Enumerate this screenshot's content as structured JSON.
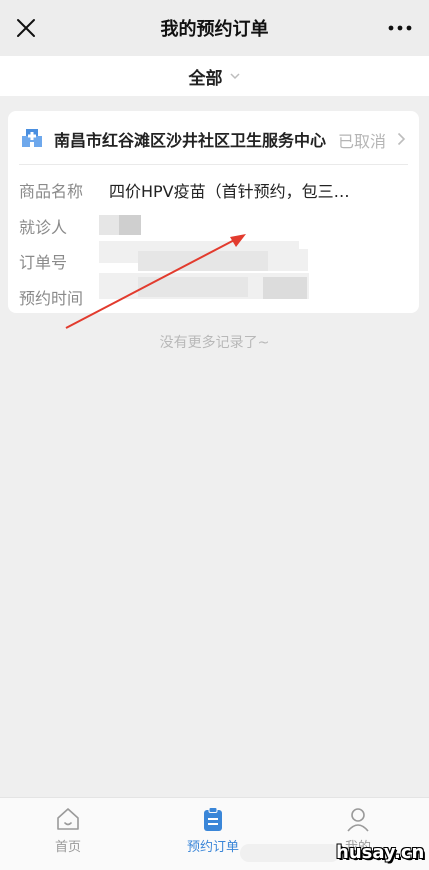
{
  "header": {
    "title": "我的预约订单",
    "close_icon": "close-icon",
    "more_icon": "more-icon"
  },
  "filter": {
    "label": "全部",
    "icon": "chevron-down-icon"
  },
  "order": {
    "hospital_name": "南昌市红谷滩区沙井社区卫生服务中心",
    "hospital_icon": "hospital-icon",
    "status": "已取消",
    "fields": [
      {
        "label": "商品名称",
        "value": "四价HPV疫苗（首针预约，包三…"
      },
      {
        "label": "就诊人",
        "value": ""
      },
      {
        "label": "订单号",
        "value": ""
      },
      {
        "label": "预约时间",
        "value": ""
      }
    ]
  },
  "list_end_text": "没有更多记录了~",
  "tabs": [
    {
      "label": "首页",
      "icon": "home-icon",
      "active": false
    },
    {
      "label": "预约订单",
      "icon": "clipboard-icon",
      "active": true
    },
    {
      "label": "我的",
      "icon": "user-icon",
      "active": false
    }
  ],
  "colors": {
    "accent": "#3a86d8",
    "annotation": "#e23b2e",
    "status_gray": "#b5b5b5"
  },
  "watermark": "husay.cn"
}
